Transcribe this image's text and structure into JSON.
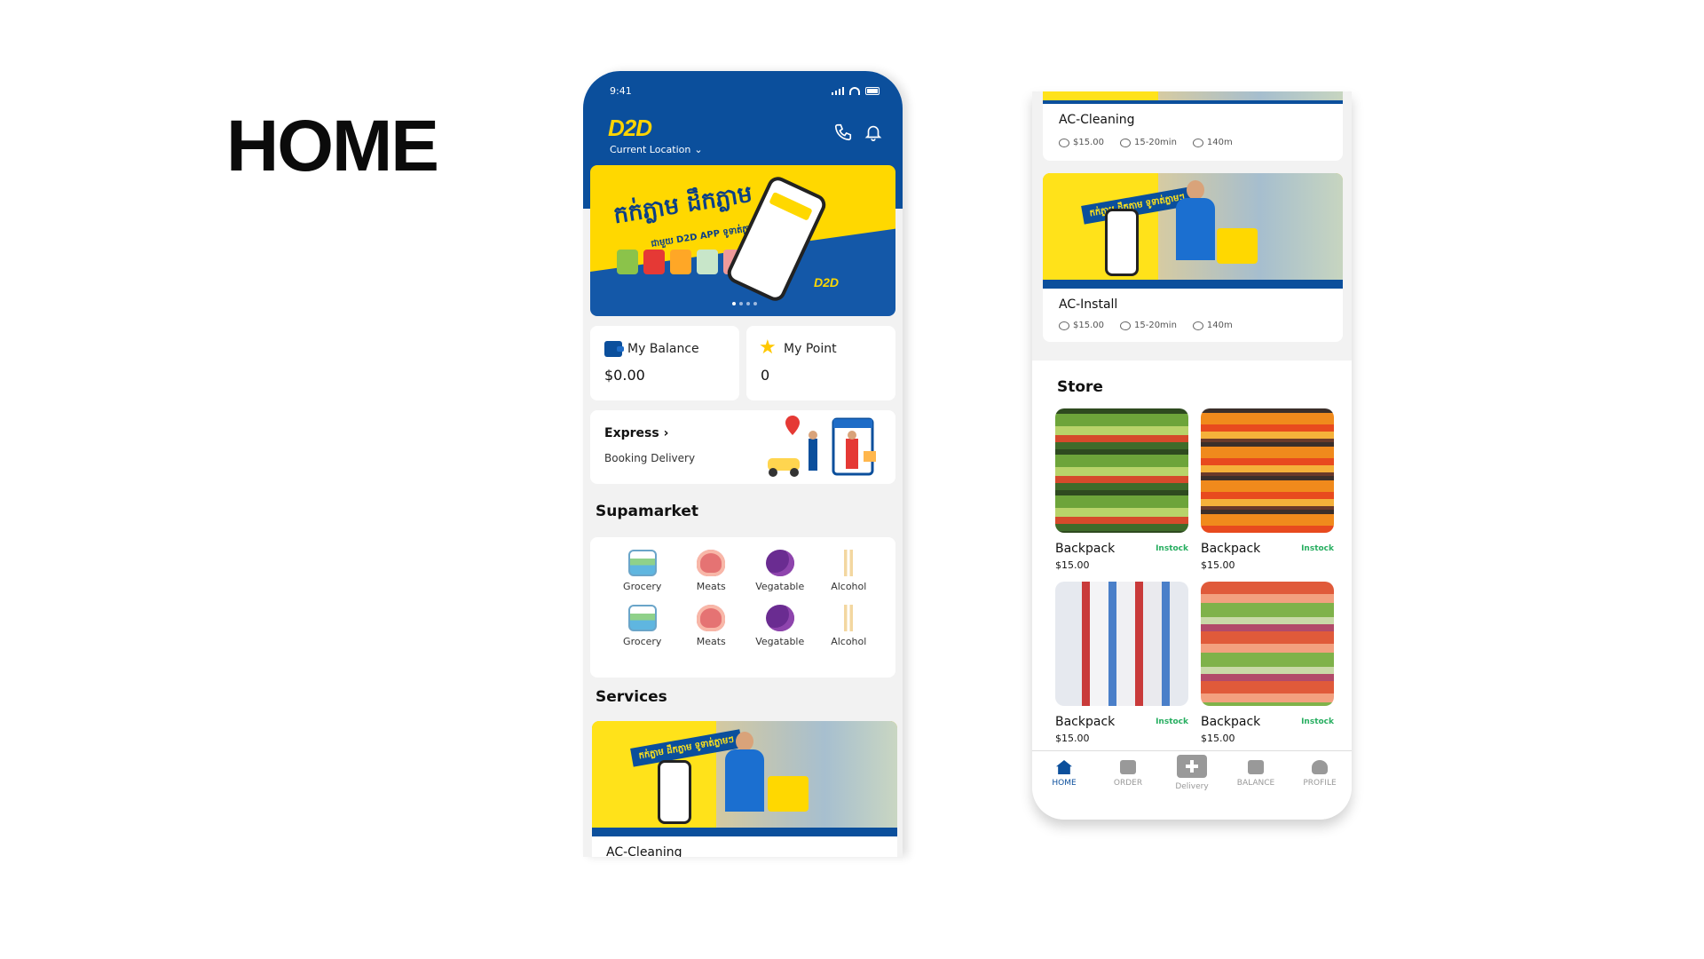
{
  "heading": "HOME",
  "phone1": {
    "status_time": "9:41",
    "logo": "D2D",
    "location_label": "Current Location",
    "banner": {
      "khmer_title": "កក់ភ្លាម ដឹកភ្លាម",
      "khmer_sub": "ជាមួយ D2D APP ទូទាត់ភ្លាមៗ",
      "logo": "D2D",
      "slides": 4,
      "active_slide": 1
    },
    "balance": {
      "label": "My Balance",
      "value": "$0.00"
    },
    "point": {
      "label": "My Point",
      "value": "0"
    },
    "express": {
      "title": "Express",
      "subtitle": "Booking Delivery"
    },
    "supermarket_title": "Supamarket",
    "categories": [
      {
        "label": "Grocery",
        "icon": "grocery-icon"
      },
      {
        "label": "Meats",
        "icon": "meat-icon"
      },
      {
        "label": "Vegatable",
        "icon": "vegetable-icon"
      },
      {
        "label": "Alcohol",
        "icon": "alcohol-icon"
      },
      {
        "label": "Grocery",
        "icon": "grocery-icon"
      },
      {
        "label": "Meats",
        "icon": "meat-icon"
      },
      {
        "label": "Vegatable",
        "icon": "vegetable-icon"
      },
      {
        "label": "Alcohol",
        "icon": "alcohol-icon"
      }
    ],
    "services_title": "Services",
    "service_banner_tag": "កក់ភ្លាម ដឹកភ្លាម ទូទាត់ភ្លាមៗ",
    "service_name": "AC-Cleaning"
  },
  "phone2": {
    "services": [
      {
        "name": "AC-Cleaning",
        "price": "$15.00",
        "time": "15-20min",
        "distance": "140m"
      },
      {
        "name": "AC-Install",
        "price": "$15.00",
        "time": "15-20min",
        "distance": "140m",
        "banner_tag": "កក់ភ្លាម ដឹកភ្លាម ទូទាត់ភ្លាមៗ"
      }
    ],
    "store_title": "Store",
    "products": [
      {
        "name": "Backpack",
        "stock": "Instock",
        "price": "$15.00"
      },
      {
        "name": "Backpack",
        "stock": "Instock",
        "price": "$15.00"
      },
      {
        "name": "Backpack",
        "stock": "Instock",
        "price": "$15.00"
      },
      {
        "name": "Backpack",
        "stock": "Instock",
        "price": "$15.00"
      }
    ],
    "nav": [
      {
        "label": "HOME",
        "icon": "home-icon",
        "active": true
      },
      {
        "label": "ORDER",
        "icon": "cart-icon",
        "active": false
      },
      {
        "label": "Delivery",
        "icon": "plus-icon",
        "active": false
      },
      {
        "label": "BALANCE",
        "icon": "wallet-icon",
        "active": false
      },
      {
        "label": "PROFILE",
        "icon": "user-icon",
        "active": false
      }
    ]
  }
}
